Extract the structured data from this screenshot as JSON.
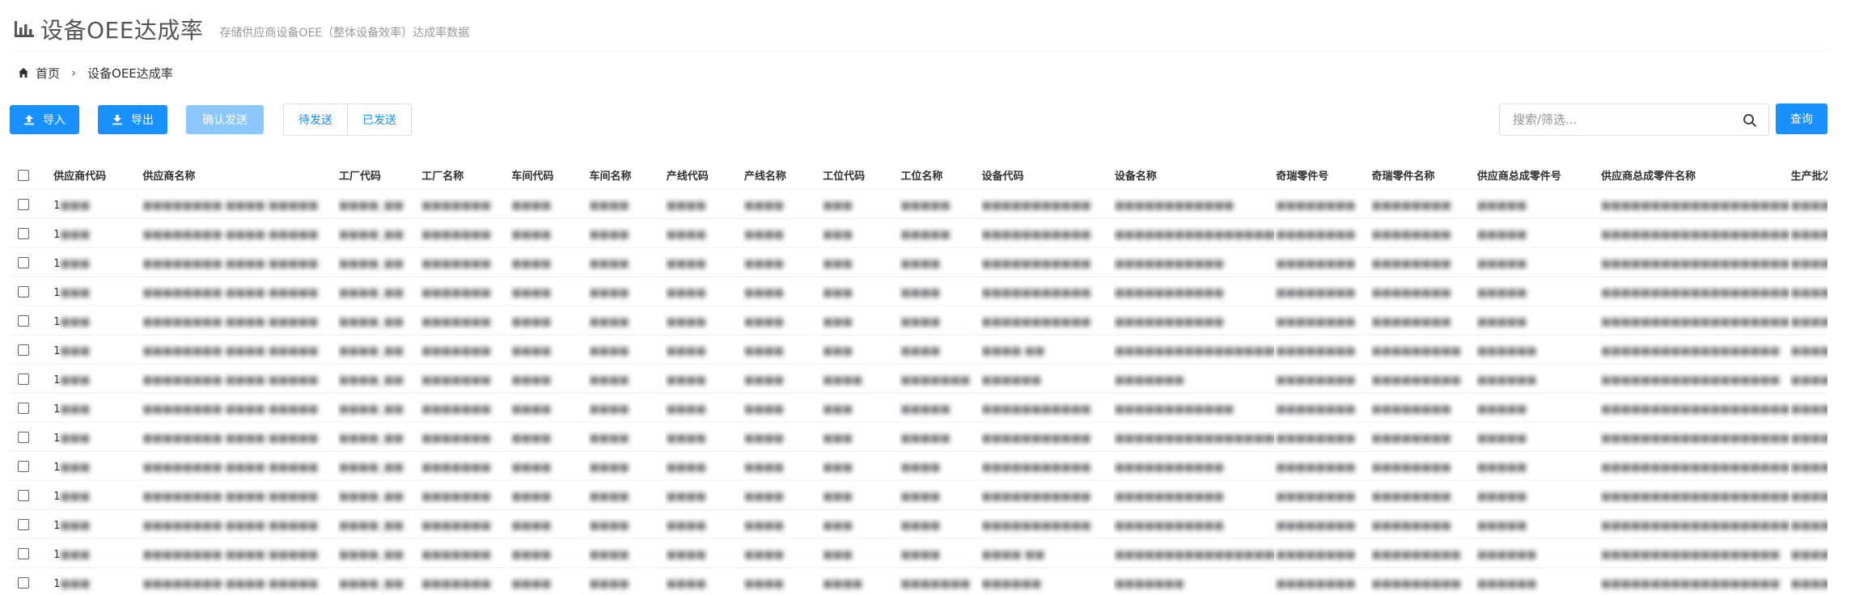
{
  "header": {
    "title": "设备OEE达成率",
    "subtitle": "存储供应商设备OEE（整体设备效率）达成率数据",
    "icon": "bar-chart-icon"
  },
  "breadcrumb": {
    "home": "首页",
    "separator": "›",
    "current": "设备OEE达成率"
  },
  "toolbar": {
    "import_label": "导入",
    "export_label": "导出",
    "confirm_label": "确认发送",
    "pending_label": "待发送",
    "sent_label": "已发送",
    "search_placeholder": "搜索/筛选...",
    "query_label": "查询"
  },
  "colors": {
    "primary": "#1890ff",
    "primary_disabled": "#8cc8ff",
    "border": "#dcdfe6"
  },
  "table": {
    "columns": [
      "供应商代码",
      "供应商名称",
      "工厂代码",
      "工厂名称",
      "车间代码",
      "车间名称",
      "产线代码",
      "产线名称",
      "工位代码",
      "工位名称",
      "设备代码",
      "设备名称",
      "奇瑞零件号",
      "奇瑞零件名称",
      "供应商总成零件号",
      "供应商总成零件名称",
      "生产批次"
    ],
    "rows": [
      [
        "1",
        "■■■■■■■■ ■■■■ ■■■■■",
        "■■■■_■■",
        "■■■■■■■",
        "■■■■",
        "■■■■",
        "■■■■",
        "■■■■",
        "■■■",
        "■■■■■",
        "■■■■■■■■■■■",
        "■■■■■■■■■■■■",
        "■■■■■■■■",
        "■■■■■■■■",
        "■■■■■",
        "■■■■■■■■■■■■■■■■■■■",
        "■■■■"
      ],
      [
        "1",
        "■■■■■■■■ ■■■■ ■■■■■",
        "■■■■_■■",
        "■■■■■■■",
        "■■■■",
        "■■■■",
        "■■■■",
        "■■■■",
        "■■■",
        "■■■■■",
        "■■■■■■■■■■■",
        "■■■■■■■■■■■■■■■■■■",
        "■■■■■■■■",
        "■■■■■■■■",
        "■■■■■",
        "■■■■■■■■■■■■■■■■■■■",
        "■■■■"
      ],
      [
        "1",
        "■■■■■■■■ ■■■■ ■■■■■",
        "■■■■_■■",
        "■■■■■■■",
        "■■■■",
        "■■■■",
        "■■■■",
        "■■■■",
        "■■■",
        "■■■■",
        "■■■■■■■■■■■",
        "■■■■■■■■■■■",
        "■■■■■■■■",
        "■■■■■■■■",
        "■■■■■",
        "■■■■■■■■■■■■■■■■■■■",
        "■■■■"
      ],
      [
        "1",
        "■■■■■■■■ ■■■■ ■■■■■",
        "■■■■_■■",
        "■■■■■■■",
        "■■■■",
        "■■■■",
        "■■■■",
        "■■■■",
        "■■■",
        "■■■■",
        "■■■■■■■■■■■",
        "■■■■■■■■■■■",
        "■■■■■■■■",
        "■■■■■■■■",
        "■■■■■",
        "■■■■■■■■■■■■■■■■■■■",
        "■■■■"
      ],
      [
        "1",
        "■■■■■■■■ ■■■■ ■■■■■",
        "■■■■_■■",
        "■■■■■■■",
        "■■■■",
        "■■■■",
        "■■■■",
        "■■■■",
        "■■■",
        "■■■■",
        "■■■■■■■■■■■",
        "■■■■■■■■■■■",
        "■■■■■■■■",
        "■■■■■■■■",
        "■■■■■",
        "■■■■■■■■■■■■■■■■■■■",
        "■■■■"
      ],
      [
        "1",
        "■■■■■■■■ ■■■■ ■■■■■",
        "■■■■_■■",
        "■■■■■■■",
        "■■■■",
        "■■■■",
        "■■■■",
        "■■■■",
        "■■■",
        "■■■■",
        "■■■■ ■■",
        "■■■■■■■■■■■■■■■■■",
        "■■■■■■■■",
        "■■■■■■■■■",
        "■■■■■■",
        "■■■■■■■■■■■■■■■■■■",
        "■■■■"
      ],
      [
        "1",
        "■■■■■■■■ ■■■■ ■■■■■",
        "■■■■_■■",
        "■■■■■■■",
        "■■■■",
        "■■■■",
        "■■■■",
        "■■■■",
        "■■■■",
        "■■■■■■■",
        "■■■■■■",
        "■■■■■■■",
        "■■■■■■■■",
        "■■■■■■■■■",
        "■■■■■■",
        "■■■■■■■■■■■■■■■■■■",
        "■■■■"
      ],
      [
        "1",
        "■■■■■■■■ ■■■■ ■■■■■",
        "■■■■_■■",
        "■■■■■■■",
        "■■■■",
        "■■■■",
        "■■■■",
        "■■■■",
        "■■■",
        "■■■■■",
        "■■■■■■■■■■■",
        "■■■■■■■■■■■■",
        "■■■■■■■■",
        "■■■■■■■■",
        "■■■■■",
        "■■■■■■■■■■■■■■■■■■■",
        "■■■■"
      ],
      [
        "1",
        "■■■■■■■■ ■■■■ ■■■■■",
        "■■■■_■■",
        "■■■■■■■",
        "■■■■",
        "■■■■",
        "■■■■",
        "■■■■",
        "■■■",
        "■■■■■",
        "■■■■■■■■■■■",
        "■■■■■■■■■■■■■■■■■■",
        "■■■■■■■■",
        "■■■■■■■■",
        "■■■■■",
        "■■■■■■■■■■■■■■■■■■■",
        "■■■■"
      ],
      [
        "1",
        "■■■■■■■■ ■■■■ ■■■■■",
        "■■■■_■■",
        "■■■■■■■",
        "■■■■",
        "■■■■",
        "■■■■",
        "■■■■",
        "■■■",
        "■■■■",
        "■■■■■■■■■■■",
        "■■■■■■■■■■■",
        "■■■■■■■■",
        "■■■■■■■■",
        "■■■■■",
        "■■■■■■■■■■■■■■■■■■■",
        "■■■■"
      ],
      [
        "1",
        "■■■■■■■■ ■■■■ ■■■■■",
        "■■■■_■■",
        "■■■■■■■",
        "■■■■",
        "■■■■",
        "■■■■",
        "■■■■",
        "■■■",
        "■■■■",
        "■■■■■■■■■■■",
        "■■■■■■■■■■■",
        "■■■■■■■■",
        "■■■■■■■■",
        "■■■■■",
        "■■■■■■■■■■■■■■■■■■■",
        "■■■■"
      ],
      [
        "1",
        "■■■■■■■■ ■■■■ ■■■■■",
        "■■■■_■■",
        "■■■■■■■",
        "■■■■",
        "■■■■",
        "■■■■",
        "■■■■",
        "■■■",
        "■■■■",
        "■■■■■■■■■■■",
        "■■■■■■■■■■■",
        "■■■■■■■■",
        "■■■■■■■■",
        "■■■■■",
        "■■■■■■■■■■■■■■■■■■■",
        "■■■■"
      ],
      [
        "1",
        "■■■■■■■■ ■■■■ ■■■■■",
        "■■■■_■■",
        "■■■■■■■",
        "■■■■",
        "■■■■",
        "■■■■",
        "■■■■",
        "■■■",
        "■■■■",
        "■■■■ ■■",
        "■■■■■■■■■■■■■■■■■",
        "■■■■■■■■",
        "■■■■■■■■■",
        "■■■■■■",
        "■■■■■■■■■■■■■■■■■■",
        "■■■■"
      ],
      [
        "1",
        "■■■■■■■■ ■■■■ ■■■■■",
        "■■■■_■■",
        "■■■■■■■",
        "■■■■",
        "■■■■",
        "■■■■",
        "■■■■",
        "■■■■",
        "■■■■■■■",
        "■■■■■■",
        "■■■■■■■",
        "■■■■■■■■",
        "■■■■■■■■■",
        "■■■■■■",
        "■■■■■■■■■■■■■■■■■■",
        "■■■■"
      ]
    ]
  }
}
